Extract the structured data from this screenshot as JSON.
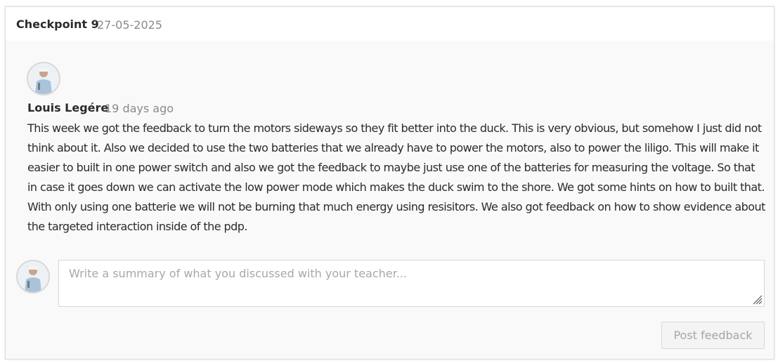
{
  "checkpoint": {
    "title": "Checkpoint 9",
    "date": "27-05-2025"
  },
  "comment": {
    "author": "Louis Legére",
    "time_ago": "19 days ago",
    "avatar_icon": "user-avatar-icon",
    "body": "This week we got the feedback to turn the motors sideways so they fit better into the duck. This is very obvious, but somehow I just did not think about it. Also we decided to use the two batteries that we already have to power the motors, also to power the liligo. This will make it easier to built in one power switch and also we got the feedback to maybe just use one of the batteries for measuring the voltage. So that in case it goes down we can activate the low power mode which makes the duck swim to the shore. We got some hints on how to built that. With only using one batterie we will not be burning that much energy using resisitors. We also got feedback on how to show evidence about the targeted interaction inside of the pdp."
  },
  "reply": {
    "value": "",
    "placeholder": "Write a summary of what you discussed with your teacher...",
    "post_label": "Post feedback"
  },
  "colors": {
    "card_background": "#f9f9f9",
    "header_background": "#ffffff",
    "text": "#2b2b2b",
    "muted_text": "#8a8a8a",
    "border": "#dcdcdc",
    "disabled_button_text": "#a6a6a6"
  }
}
